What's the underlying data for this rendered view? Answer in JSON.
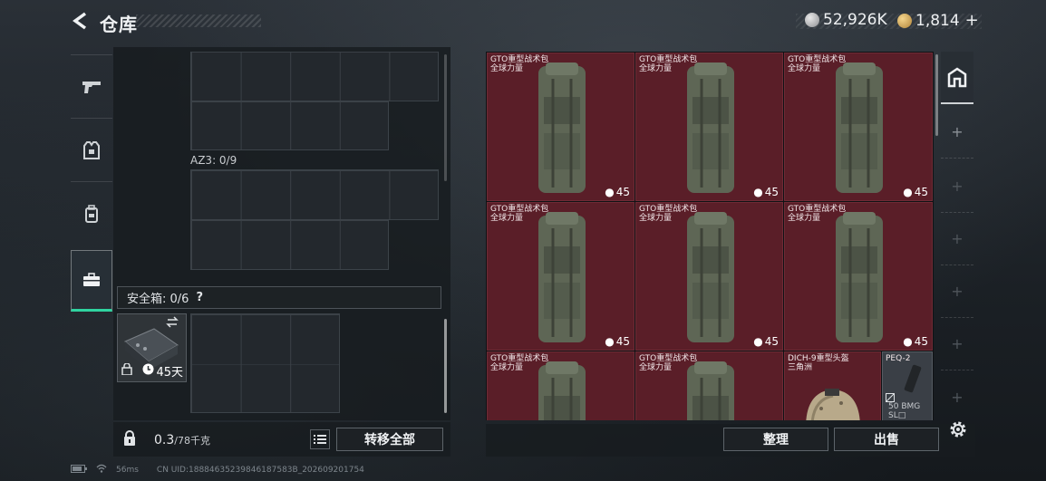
{
  "header": {
    "title": "仓库",
    "currency_silver": "52,926K",
    "currency_gold": "1,814",
    "plus": "+"
  },
  "sidebar": {
    "items": [
      {
        "icon": "pistol-icon"
      },
      {
        "icon": "armor-vest-icon"
      },
      {
        "icon": "backpack-icon"
      },
      {
        "icon": "briefcase-icon",
        "active": true
      }
    ]
  },
  "left_panel": {
    "az3_label": "AZ3: 0/9",
    "safebox_label": "安全箱: 0/6",
    "safebox_help": "?",
    "safebox_days": "45天"
  },
  "left_footer": {
    "weight_value": "0.3",
    "weight_max": "/78千克",
    "transfer_all": "转移全部"
  },
  "items": [
    {
      "name": "GTO重型战术包",
      "sub": "全球力量",
      "count": "45"
    },
    {
      "name": "GTO重型战术包",
      "sub": "全球力量",
      "count": "45"
    },
    {
      "name": "GTO重型战术包",
      "sub": "全球力量",
      "count": "45"
    },
    {
      "name": "GTO重型战术包",
      "sub": "全球力量",
      "count": "45"
    },
    {
      "name": "GTO重型战术包",
      "sub": "全球力量",
      "count": "45"
    },
    {
      "name": "GTO重型战术包",
      "sub": "全球力量",
      "count": "45"
    },
    {
      "name": "GTO重型战术包",
      "sub": "全球力量",
      "count": ""
    },
    {
      "name": "GTO重型战术包",
      "sub": "全球力量",
      "count": ""
    },
    {
      "name": "DICH-9重型头盔",
      "sub": "三角洲",
      "count": ""
    },
    {
      "name": "PEQ-2",
      "sub": "",
      "count": "",
      "tag": "50 BMG",
      "tag2": "SL□"
    }
  ],
  "right_footer": {
    "sort": "整理",
    "sell": "出售"
  },
  "status": {
    "ping": "56ms",
    "uid": "CN UID:18884635239846187583B_202609201754"
  },
  "colors": {
    "accent": "#2fd4a0",
    "item_bg": "#5a1e28"
  }
}
